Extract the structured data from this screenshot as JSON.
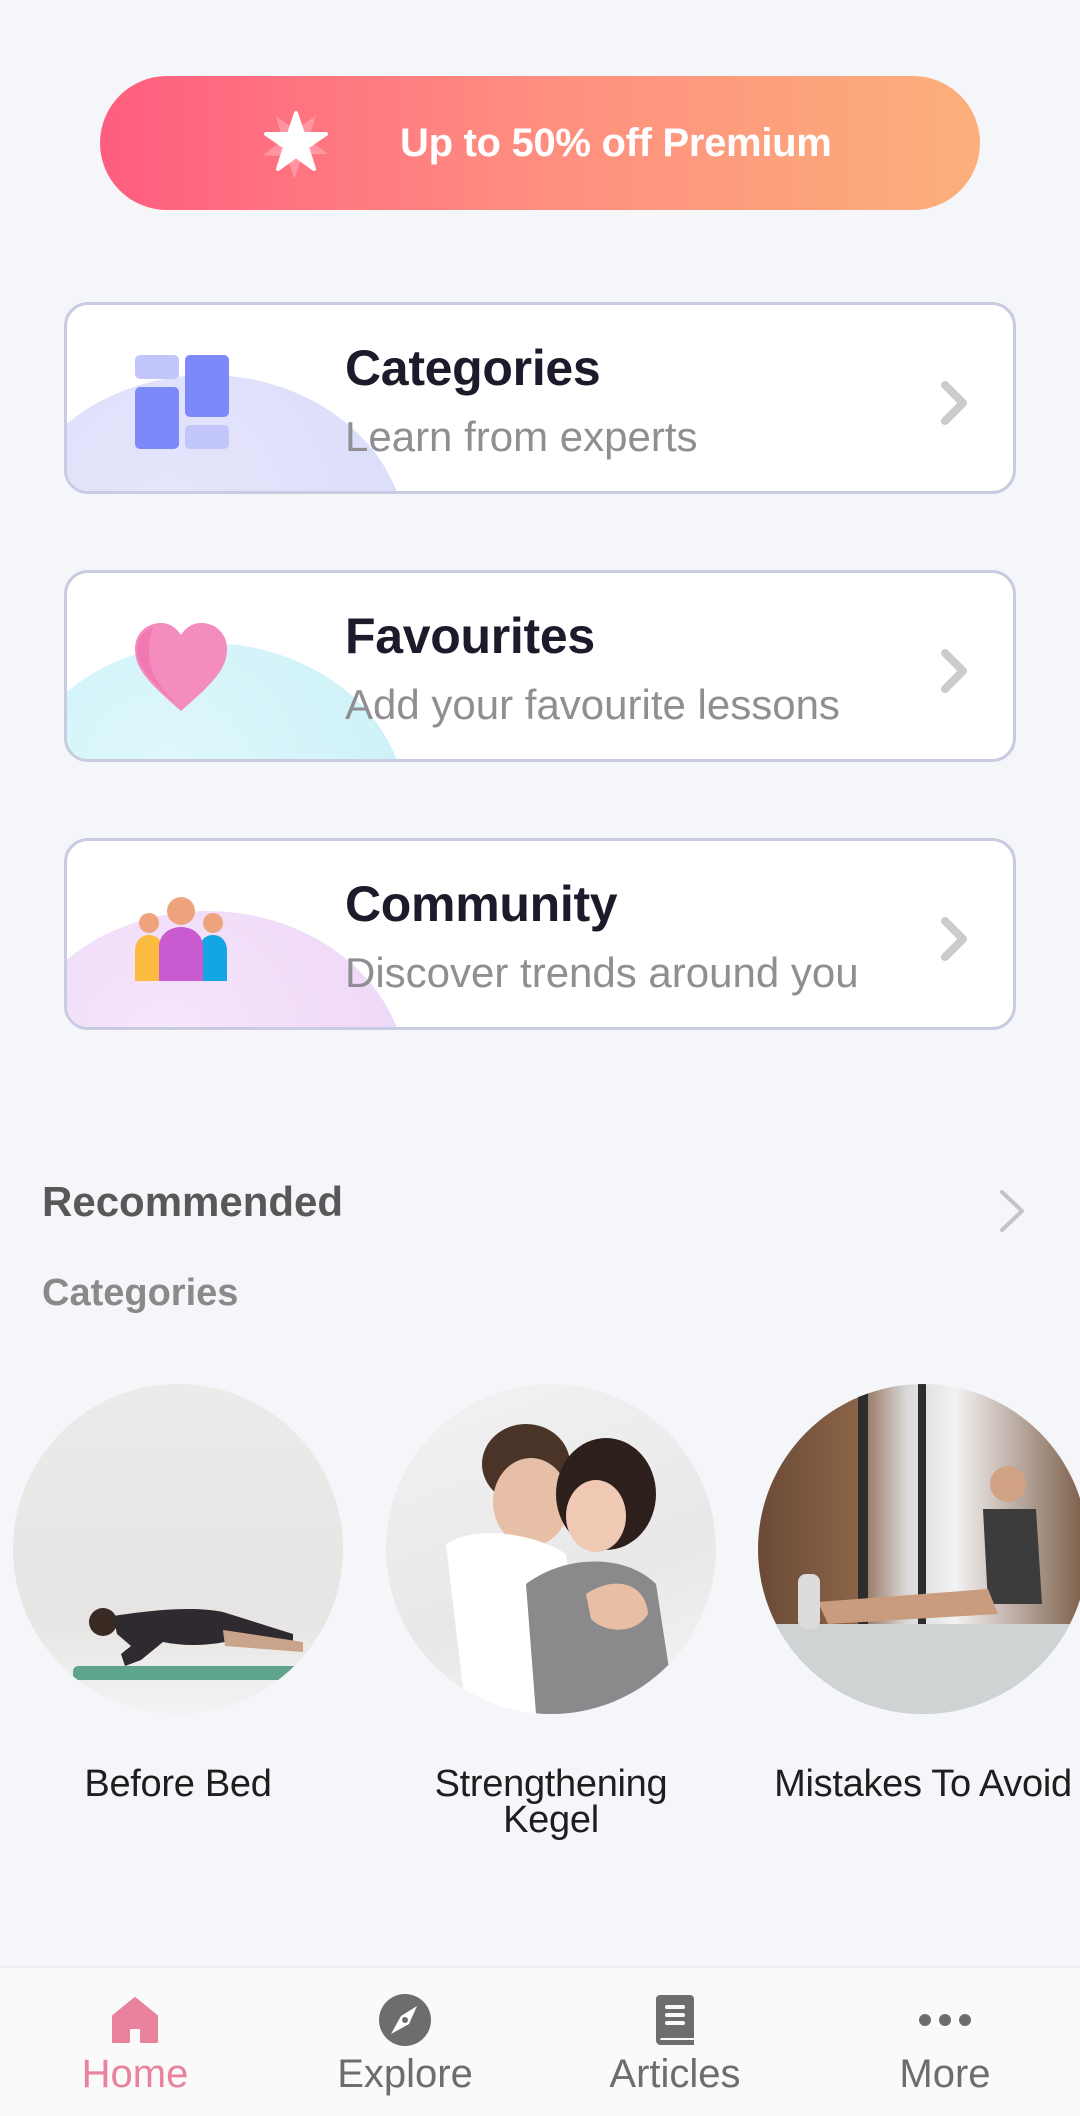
{
  "promo": {
    "label": "Up to 50% off Premium",
    "icon": "star-icon",
    "gradient_start": "#fe5d7f",
    "gradient_end": "#fbb07a"
  },
  "menu_cards": [
    {
      "title": "Categories",
      "subtitle": "Learn from experts",
      "icon": "categories-grid-icon",
      "blob_color": "#dcdcfb"
    },
    {
      "title": "Favourites",
      "subtitle": "Add your favourite lessons",
      "icon": "heart-icon",
      "blob_color": "#cdf3f8"
    },
    {
      "title": "Community",
      "subtitle": "Discover trends around you",
      "icon": "community-people-icon",
      "blob_color": "#f0daf8"
    }
  ],
  "recommended": {
    "title": "Recommended",
    "subtitle": "Categories",
    "items": [
      {
        "label": "Before Bed",
        "image": "man doing plank on mat"
      },
      {
        "label": "Strengthening Kegel",
        "image": "couple cuddling in bed"
      },
      {
        "label": "Mistakes To Avoid",
        "image": "man stretching on gym floor"
      }
    ]
  },
  "bottom_nav": {
    "active_color": "#e9829c",
    "items": [
      {
        "label": "Home",
        "icon": "home-icon",
        "active": true
      },
      {
        "label": "Explore",
        "icon": "compass-icon",
        "active": false
      },
      {
        "label": "Articles",
        "icon": "book-icon",
        "active": false
      },
      {
        "label": "More",
        "icon": "more-dots-icon",
        "active": false
      }
    ]
  }
}
